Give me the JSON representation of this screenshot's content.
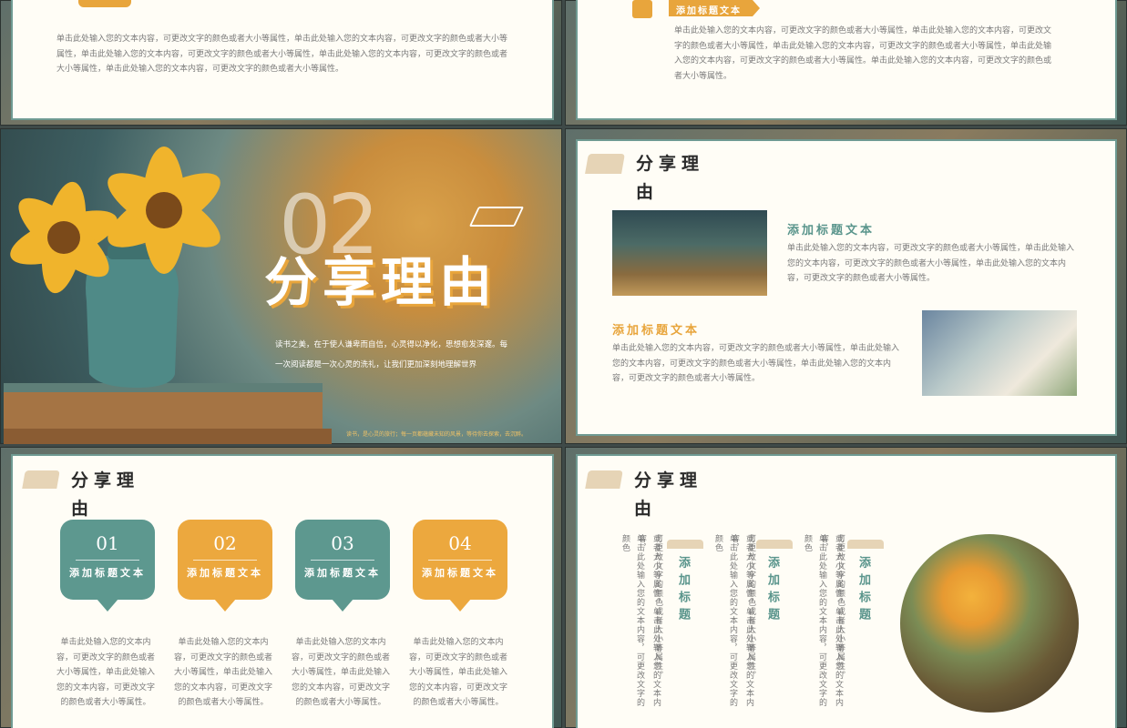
{
  "slide1": {
    "body": "单击此处输入您的文本内容，可更改文字的颜色或者大小等属性，单击此处输入您的文本内容，可更改文字的颜色或者大小等属性，单击此处输入您的文本内容，可更改文字的颜色或者大小等属性，单击此处输入您的文本内容，可更改文字的颜色或者大小等属性，单击此处输入您的文本内容，可更改文字的颜色或者大小等属性。"
  },
  "slide2": {
    "tag": "添加标题文本",
    "body": "单击此处输入您的文本内容，可更改文字的颜色或者大小等属性，单击此处输入您的文本内容，可更改文字的颜色或者大小等属性，单击此处输入您的文本内容，可更改文字的颜色或者大小等属性，单击此处输入您的文本内容，可更改文字的颜色或者大小等属性。单击此处输入您的文本内容，可更改文字的颜色或者大小等属性。"
  },
  "slide3": {
    "number": "02",
    "title": "分享理由",
    "line1": "读书之美，在于使人谦卑而自信，心灵得以净化，思想愈发深邃。每",
    "line2": "一次阅读都是一次心灵的洗礼，让我们更加深刻地理解世界",
    "footer": "读书，是心灵的旅行；每一页都蕴藏未知的风景，等待你去探索，去沉醉。"
  },
  "slide5": {
    "heading": "分享理由",
    "item1_title": "添加标题文本",
    "item1_body": "单击此处输入您的文本内容，可更改文字的颜色或者大小等属性，单击此处输入您的文本内容，可更改文字的颜色或者大小等属性，单击此处输入您的文本内容，可更改文字的颜色或者大小等属性。",
    "item2_title": "添加标题文本",
    "item2_body": "单击此处输入您的文本内容，可更改文字的颜色或者大小等属性，单击此处输入您的文本内容，可更改文字的颜色或者大小等属性，单击此处输入您的文本内容，可更改文字的颜色或者大小等属性。"
  },
  "slide4": {
    "heading": "分享理由",
    "boxes": [
      {
        "num": "01",
        "title": "添加标题文本",
        "color": "#5d988f"
      },
      {
        "num": "02",
        "title": "添加标题文本",
        "color": "#eca83e"
      },
      {
        "num": "03",
        "title": "添加标题文本",
        "color": "#5d988f"
      },
      {
        "num": "04",
        "title": "添加标题文本",
        "color": "#eca83e"
      }
    ],
    "desc": "单击此处输入您的文本内容，可更改文字的颜色或者大小等属性，单击此处输入您的文本内容，可更改文字的颜色或者大小等属性。"
  },
  "slide6": {
    "heading": "分享理由",
    "col_title": "添加标题",
    "col_text_a": "单击此处输入您的文本内容，可更改文字的颜色",
    "col_text_b": "或者大小等属性，单击此处输入您的文本内容，",
    "col_text_c": "可更改文字的颜色或者大小等属性。"
  },
  "colors": {
    "teal": "#5a958c",
    "orange": "#e8a53c",
    "card": "#fffdf6"
  }
}
